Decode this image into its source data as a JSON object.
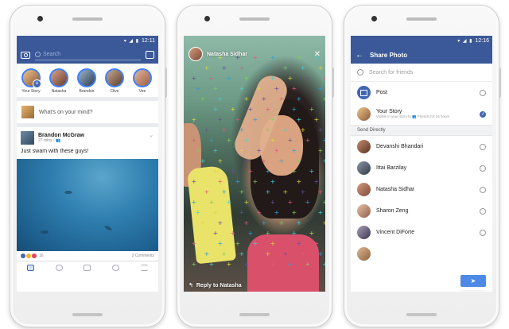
{
  "phone1": {
    "status_time": "12:11",
    "search_placeholder": "Search",
    "stories": [
      {
        "name": "Your Story"
      },
      {
        "name": "Natasha"
      },
      {
        "name": "Brandon"
      },
      {
        "name": "Clive"
      },
      {
        "name": "Vee"
      }
    ],
    "composer_placeholder": "What's on your mind?",
    "post": {
      "author": "Brandon McGraw",
      "time": "27 mins · ",
      "text": "Just swam with these guys!",
      "reaction_count": "16",
      "comments": "2 Comments"
    }
  },
  "phone2": {
    "story_author": "Natasha Sidhar",
    "close": "✕",
    "reply_label": "Reply to Natasha",
    "reply_icon": "↰"
  },
  "phone3": {
    "status_time": "12:16",
    "title": "Share Photo",
    "back_icon": "←",
    "search_placeholder": "Search for friends",
    "post_label": "Post",
    "your_story_label": "Your Story",
    "your_story_sub": "Visible in your story to 👥 Friends  for 24 hours",
    "section_label": "Send Directly",
    "friends": [
      {
        "name": "Devanshi Bhandari"
      },
      {
        "name": "Ittai Barzilay"
      },
      {
        "name": "Natasha Sidhar"
      },
      {
        "name": "Sharon Zeng"
      },
      {
        "name": "Vincent DiForte"
      }
    ],
    "send_icon": "➤"
  },
  "colors": {
    "fb_blue": "#3b5998",
    "accent": "#4267b2"
  }
}
